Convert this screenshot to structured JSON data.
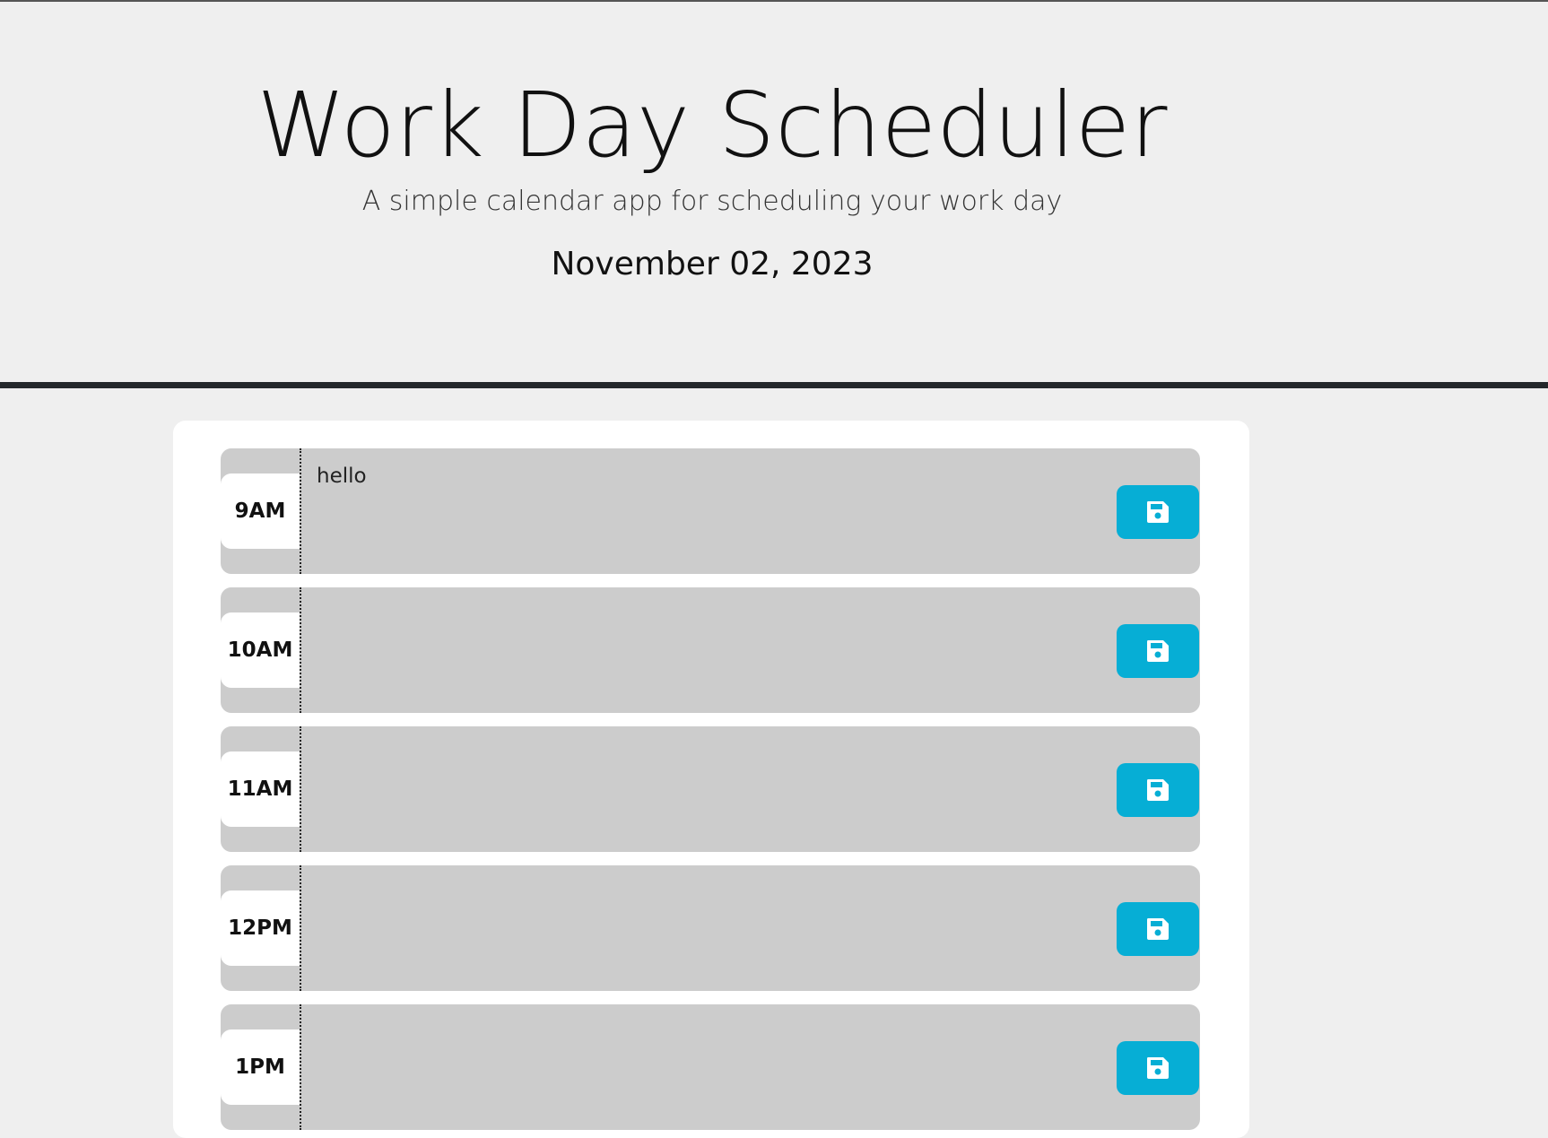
{
  "header": {
    "title": "Work Day Scheduler",
    "lead": "A simple calendar app for scheduling your work day",
    "date": "November 02, 2023"
  },
  "rows": [
    {
      "hour": "9AM",
      "text": "hello",
      "save_icon": "floppy-disk-icon"
    },
    {
      "hour": "10AM",
      "text": "",
      "save_icon": "floppy-disk-icon"
    },
    {
      "hour": "11AM",
      "text": "",
      "save_icon": "floppy-disk-icon"
    },
    {
      "hour": "12PM",
      "text": "",
      "save_icon": "floppy-disk-icon"
    },
    {
      "hour": "1PM",
      "text": "",
      "save_icon": "floppy-disk-icon"
    }
  ],
  "colors": {
    "row_background": "#cccccc",
    "save_button": "#06aed5",
    "header_rule": "#24282b"
  }
}
